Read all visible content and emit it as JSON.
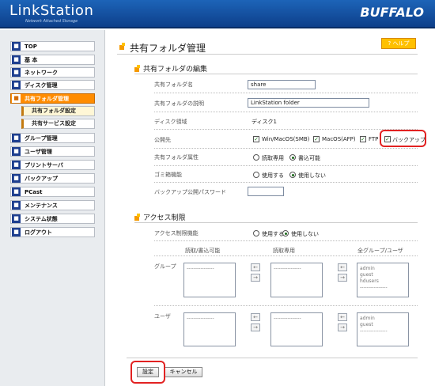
{
  "header": {
    "logo": "LinkStation",
    "logo_sub": "Network Attached Storage",
    "brand": "BUFFALO"
  },
  "sidebar": {
    "items": [
      {
        "label": "TOP",
        "icon": "■"
      },
      {
        "label": "基 本",
        "icon": "■"
      },
      {
        "label": "ネットワーク",
        "icon": "■"
      },
      {
        "label": "ディスク管理",
        "icon": "■"
      },
      {
        "label": "共有フォルダ管理",
        "icon": "■"
      },
      {
        "label": "グループ管理",
        "icon": "■"
      },
      {
        "label": "ユーザ管理",
        "icon": "■"
      },
      {
        "label": "プリントサーバ",
        "icon": "■"
      },
      {
        "label": "バックアップ",
        "icon": "■"
      },
      {
        "label": "PCast",
        "icon": "■"
      },
      {
        "label": "メンテナンス",
        "icon": "■"
      },
      {
        "label": "システム状態",
        "icon": "■"
      },
      {
        "label": "ログアウト",
        "icon": "■"
      }
    ],
    "sub_items": [
      {
        "label": "共有フォルダ設定"
      },
      {
        "label": "共有サービス設定"
      }
    ]
  },
  "main": {
    "title": "共有フォルダ管理",
    "help": "? ヘルプ",
    "section_edit": "共有フォルダの編集",
    "fields": {
      "name_label": "共有フォルダ名",
      "name_value": "share",
      "desc_label": "共有フォルダの説明",
      "desc_value": "LinkStation folder",
      "disk_label": "ディスク領域",
      "disk_value": "ディスク1",
      "public_label": "公開先",
      "public_options": [
        {
          "label": "Win/MacOS(SMB)",
          "checked": true
        },
        {
          "label": "MacOS(AFP)",
          "checked": true
        },
        {
          "label": "FTP",
          "checked": true
        },
        {
          "label": "バックアップ",
          "checked": true
        }
      ],
      "attr_label": "共有フォルダ属性",
      "attr_options": [
        "読取専用",
        "書込可能"
      ],
      "attr_selected": "書込可能",
      "trash_label": "ゴミ箱機能",
      "trash_options": [
        "使用する",
        "使用しない"
      ],
      "trash_selected": "使用しない",
      "backup_pw_label": "バックアップ公開パスワード",
      "backup_pw_value": ""
    },
    "section_access": "アクセス制限",
    "access": {
      "label": "アクセス制限機能",
      "options": [
        "使用する",
        "使用しない"
      ],
      "selected": "使用しない",
      "col_rw": "読取/書込可能",
      "col_ro": "読取専用",
      "col_all": "全グループ/ユーザ",
      "group_label": "グループ",
      "user_label": "ユーザ",
      "placeholder": "----------------",
      "all_groups": [
        "admin",
        "guest",
        "hdusers"
      ],
      "all_users": [
        "admin",
        "guest"
      ],
      "arrow_left": "←",
      "arrow_right": "→"
    },
    "buttons": {
      "submit": "設定",
      "cancel": "キャンセル"
    }
  }
}
